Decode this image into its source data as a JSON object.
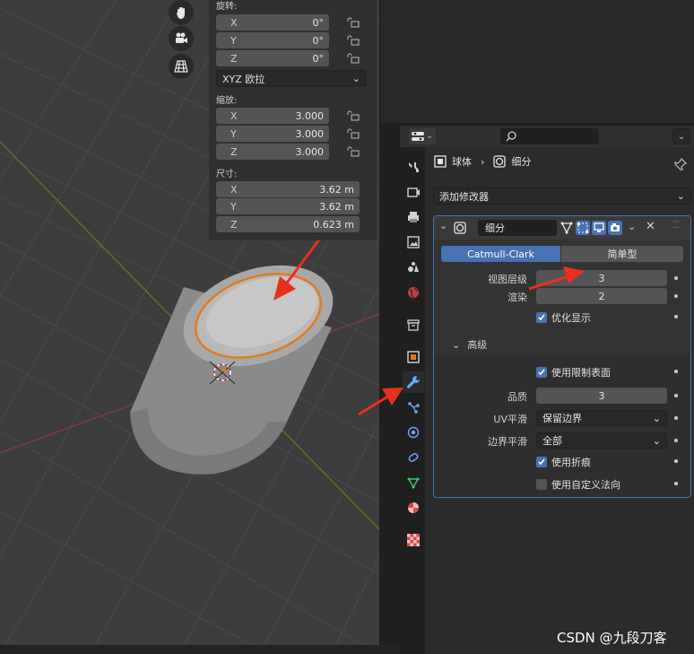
{
  "colors": {
    "accent": "#4772b3",
    "annotation_arrow": "#e8301f",
    "selection_outline": "#e07b1f"
  },
  "viewport": {
    "nav_icons": [
      "hand-pan-icon",
      "camera-icon",
      "grid-icon"
    ],
    "transform": {
      "rotation_label": "旋转:",
      "rotation": [
        {
          "axis": "X",
          "value": "0°"
        },
        {
          "axis": "Y",
          "value": "0°"
        },
        {
          "axis": "Z",
          "value": "0°"
        }
      ],
      "rotation_mode": "XYZ 欧拉",
      "scale_label": "缩放:",
      "scale": [
        {
          "axis": "X",
          "value": "3.000"
        },
        {
          "axis": "Y",
          "value": "3.000"
        },
        {
          "axis": "Z",
          "value": "3.000"
        }
      ],
      "dimensions_label": "尺寸:",
      "dimensions": [
        {
          "axis": "X",
          "value": "3.62 m"
        },
        {
          "axis": "Y",
          "value": "3.62 m"
        },
        {
          "axis": "Z",
          "value": "0.623 m"
        }
      ]
    }
  },
  "properties": {
    "breadcrumb": {
      "object": "球体",
      "modifier": "细分"
    },
    "add_modifier": "添加修改器",
    "modifier": {
      "name": "细分",
      "tabs": [
        "Catmull-Clark",
        "简单型"
      ],
      "active_tab": "Catmull-Clark",
      "viewport_levels_label": "视图层级",
      "viewport_levels": "3",
      "render_label": "渲染",
      "render": "2",
      "optimal_display": "优化显示",
      "advanced_label": "高级",
      "use_limit_surface": "使用限制表面",
      "quality_label": "品质",
      "quality": "3",
      "uv_smooth_label": "UV平滑",
      "uv_smooth": "保留边界",
      "boundary_smooth_label": "边界平滑",
      "boundary_smooth": "全部",
      "use_creases": "使用折痕",
      "use_custom_normals": "使用自定义法向"
    }
  },
  "watermark": "CSDN @九段刀客"
}
